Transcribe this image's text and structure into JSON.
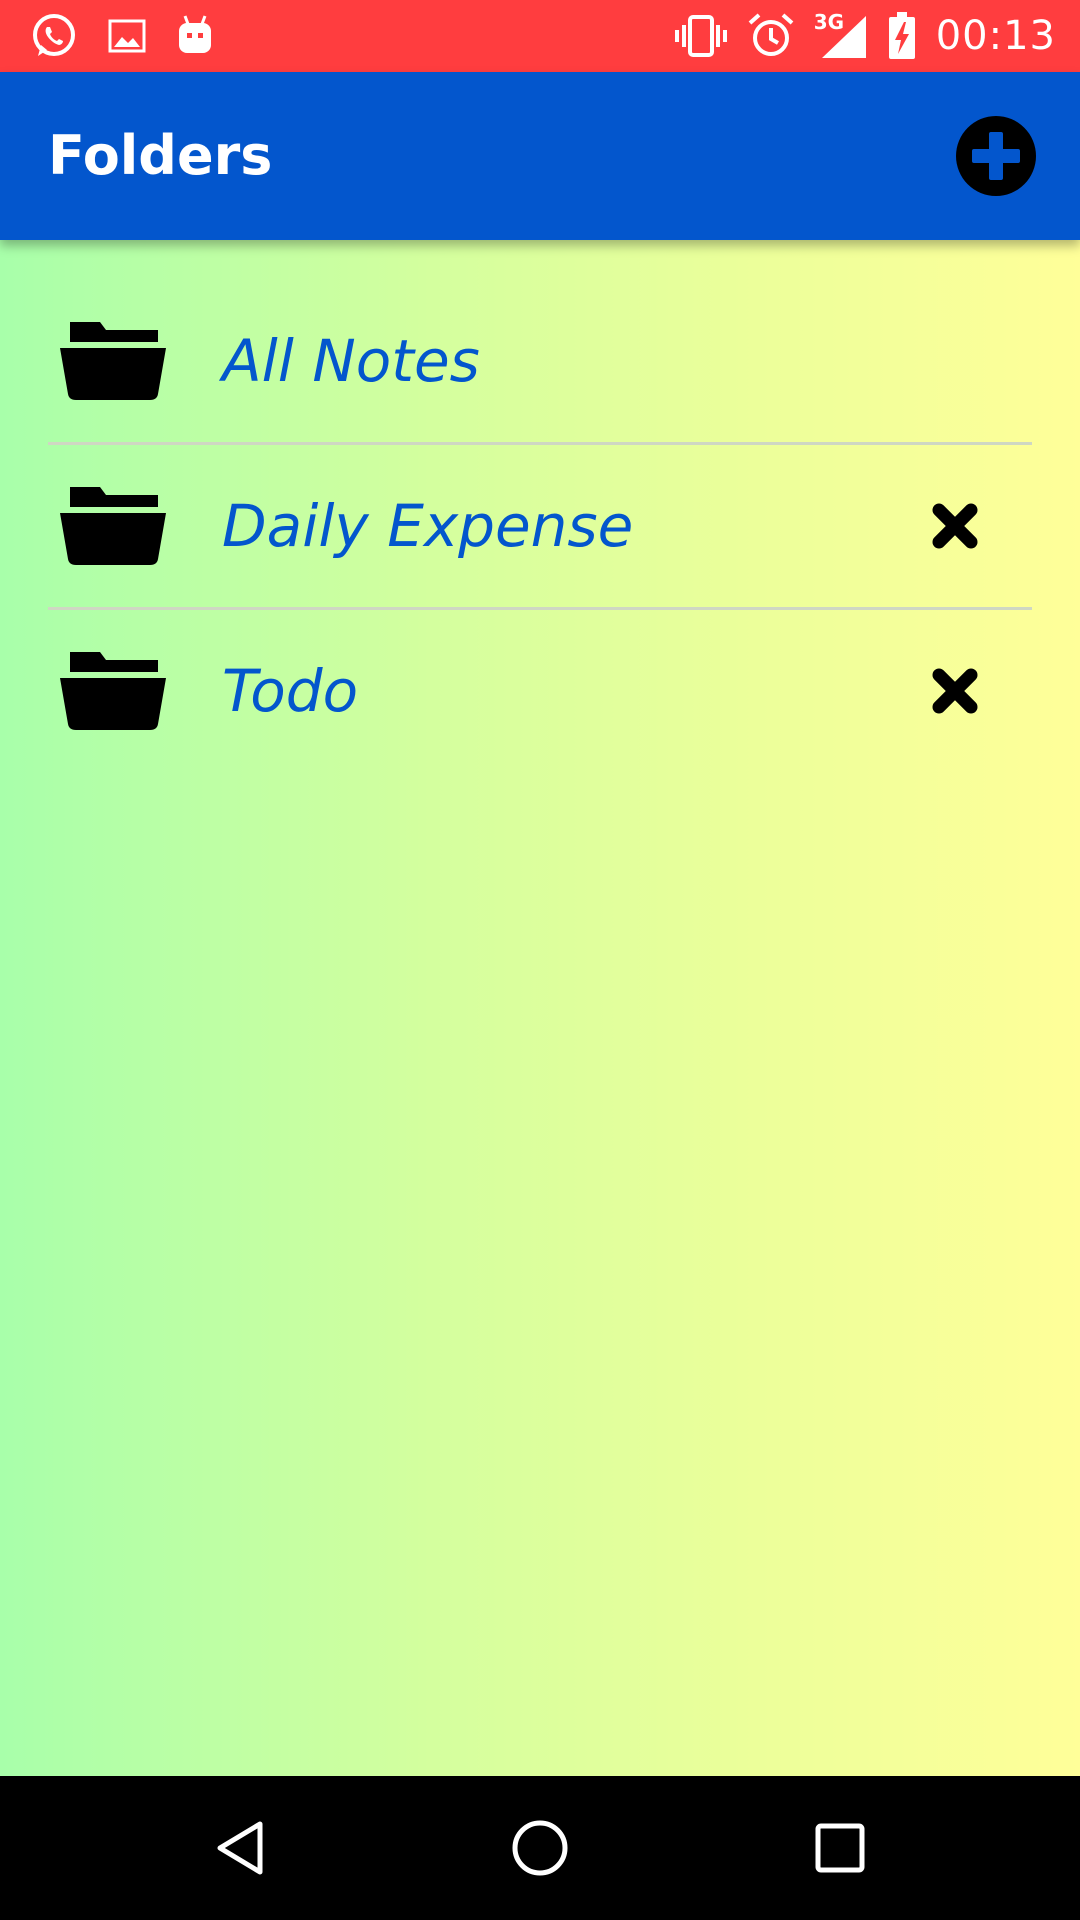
{
  "status_bar": {
    "time": "00:13",
    "network_type": "3G",
    "left_icons": [
      "whatsapp-icon",
      "image-icon",
      "android-icon"
    ],
    "right_icons": [
      "vibrate-icon",
      "alarm-icon",
      "signal-icon",
      "battery-charging-icon"
    ]
  },
  "app_bar": {
    "title": "Folders",
    "add_icon": "plus-circle-icon"
  },
  "folders": [
    {
      "name": "All Notes",
      "icon": "open-folder-icon",
      "deletable": false
    },
    {
      "name": "Daily Expense",
      "icon": "open-folder-icon",
      "deletable": true,
      "delete_icon": "close-icon"
    },
    {
      "name": "Todo",
      "icon": "open-folder-icon",
      "deletable": true,
      "delete_icon": "close-icon"
    }
  ],
  "nav_bar": {
    "buttons": [
      "back-icon",
      "home-icon",
      "recents-icon"
    ]
  },
  "colors": {
    "status_bar": "#ff3d3f",
    "app_bar": "#0356cd",
    "folder_text": "#0356cd",
    "gradient_start": "#a8ffaa",
    "gradient_end": "#ffff99",
    "nav_bar": "#000000"
  }
}
